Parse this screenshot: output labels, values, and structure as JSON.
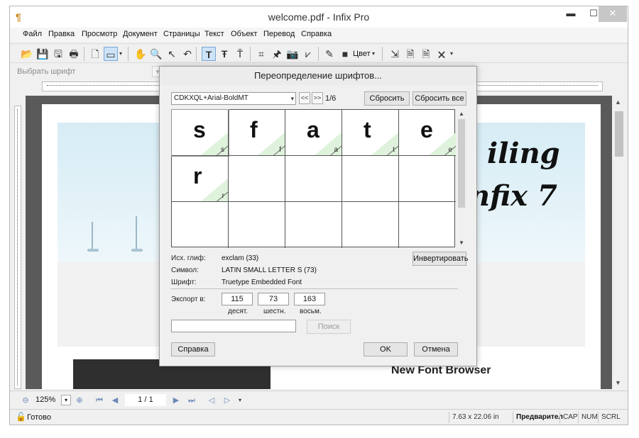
{
  "window": {
    "title": "welcome.pdf - Infix Pro",
    "controls": {
      "minimize": "▬",
      "maximize": "☐",
      "close": "✕"
    }
  },
  "menu": [
    "Файл",
    "Правка",
    "Просмотр",
    "Документ",
    "Страницы",
    "Текст",
    "Объект",
    "Перевод",
    "Справка"
  ],
  "toolbar": {
    "color_label": "Цвет",
    "icons": [
      "open-icon",
      "save-icon",
      "save-as-icon",
      "print-icon",
      "page-icon",
      "page-view-icon",
      "hand-icon",
      "zoom-icon",
      "select-arrow-icon",
      "undo-icon",
      "text-tool-icon",
      "text-frame-icon",
      "text-superscript-icon",
      "crop-icon",
      "stamp-icon",
      "camera-icon",
      "link-icon",
      "eyedropper-icon",
      "color-swatch-icon",
      "export-icon"
    ]
  },
  "fontbar": {
    "font_placeholder": "Выбрать шрифт"
  },
  "document": {
    "banner_text_1": "iling",
    "banner_text_2": "nfix 7",
    "heading": "New Font Browser"
  },
  "navbar": {
    "zoom": "125%",
    "page": "1 / 1"
  },
  "status": {
    "ready": "Готово",
    "dimensions": "7.63 x 22.06 in",
    "preview": "Предварител",
    "cap": "CAP",
    "num": "NUM",
    "scrl": "SCRL"
  },
  "dialog": {
    "title": "Переопределение шрифтов...",
    "font_combo": "CDKXQL+Arial-BoldMT",
    "prev": "<<",
    "next": ">>",
    "page_count": "1/6",
    "reset_button": "Сбросить",
    "reset_all_button": "Сбросить все",
    "glyphs": [
      {
        "big": "s",
        "small": "s"
      },
      {
        "big": "f",
        "small": "f"
      },
      {
        "big": "a",
        "small": "a"
      },
      {
        "big": "t",
        "small": "t"
      },
      {
        "big": "e",
        "small": "e"
      },
      {
        "big": "r",
        "small": "r"
      }
    ],
    "src_glyph_label": "Исх. глиф:",
    "src_glyph_value": "exclam (33)",
    "symbol_label": "Символ:",
    "symbol_value": "LATIN SMALL LETTER S (73)",
    "font_label": "Шрифт:",
    "font_value": "Truetype Embedded Font",
    "invert_button": "Инвертировать",
    "export_label": "Экспорт в:",
    "dec_value": "115",
    "hex_value": "73",
    "oct_value": "163",
    "dec_caption": "десят.",
    "hex_caption": "шестн.",
    "oct_caption": "восьм.",
    "search_value": "",
    "search_button": "Поиск",
    "help_button": "Справка",
    "ok_button": "OK",
    "cancel_button": "Отмена"
  }
}
